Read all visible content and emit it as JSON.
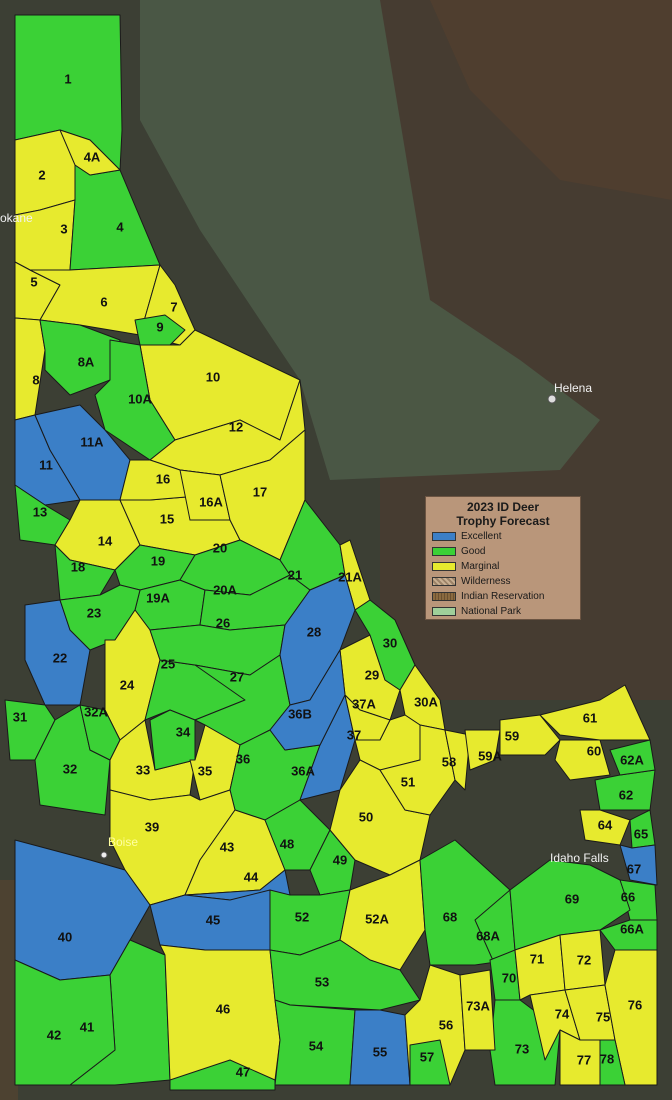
{
  "legend": {
    "title_line1": "2023 ID Deer",
    "title_line2": "Trophy Forecast",
    "items": [
      {
        "label": "Excellent",
        "color": "#3b7fc7"
      },
      {
        "label": "Good",
        "color": "#3bd136"
      },
      {
        "label": "Marginal",
        "color": "#e7ea2e"
      },
      {
        "label": "Wilderness",
        "color": "#b59c7e"
      },
      {
        "label": "Indian Reservation",
        "color": "#7a5d38"
      },
      {
        "label": "National Park",
        "color": "#9fcf9a"
      }
    ]
  },
  "cities": {
    "helena": "Helena",
    "boise": "Boise",
    "idaho_falls": "Idaho Falls",
    "spokane_partial": "okane"
  },
  "units": [
    {
      "id": "1",
      "rating": "good"
    },
    {
      "id": "2",
      "rating": "marginal"
    },
    {
      "id": "3",
      "rating": "marginal"
    },
    {
      "id": "4",
      "rating": "good"
    },
    {
      "id": "4A",
      "rating": "marginal"
    },
    {
      "id": "5",
      "rating": "marginal"
    },
    {
      "id": "6",
      "rating": "marginal"
    },
    {
      "id": "7",
      "rating": "marginal"
    },
    {
      "id": "8",
      "rating": "marginal"
    },
    {
      "id": "8A",
      "rating": "good"
    },
    {
      "id": "9",
      "rating": "good"
    },
    {
      "id": "10",
      "rating": "marginal"
    },
    {
      "id": "10A",
      "rating": "good"
    },
    {
      "id": "11",
      "rating": "excellent"
    },
    {
      "id": "11A",
      "rating": "excellent"
    },
    {
      "id": "12",
      "rating": "marginal"
    },
    {
      "id": "13",
      "rating": "good"
    },
    {
      "id": "14",
      "rating": "marginal"
    },
    {
      "id": "15",
      "rating": "marginal"
    },
    {
      "id": "16",
      "rating": "marginal"
    },
    {
      "id": "16A",
      "rating": "marginal"
    },
    {
      "id": "17",
      "rating": "marginal"
    },
    {
      "id": "18",
      "rating": "good"
    },
    {
      "id": "19",
      "rating": "good"
    },
    {
      "id": "19A",
      "rating": "good"
    },
    {
      "id": "20",
      "rating": "good"
    },
    {
      "id": "20A",
      "rating": "good"
    },
    {
      "id": "21",
      "rating": "good"
    },
    {
      "id": "21A",
      "rating": "marginal"
    },
    {
      "id": "22",
      "rating": "excellent"
    },
    {
      "id": "23",
      "rating": "good"
    },
    {
      "id": "24",
      "rating": "marginal"
    },
    {
      "id": "25",
      "rating": "good"
    },
    {
      "id": "26",
      "rating": "good"
    },
    {
      "id": "27",
      "rating": "good"
    },
    {
      "id": "28",
      "rating": "excellent"
    },
    {
      "id": "29",
      "rating": "marginal"
    },
    {
      "id": "30",
      "rating": "good"
    },
    {
      "id": "30A",
      "rating": "marginal"
    },
    {
      "id": "31",
      "rating": "good"
    },
    {
      "id": "32",
      "rating": "good"
    },
    {
      "id": "32A",
      "rating": "good"
    },
    {
      "id": "33",
      "rating": "marginal"
    },
    {
      "id": "34",
      "rating": "good"
    },
    {
      "id": "35",
      "rating": "marginal"
    },
    {
      "id": "36",
      "rating": "good"
    },
    {
      "id": "36A",
      "rating": "excellent"
    },
    {
      "id": "36B",
      "rating": "excellent"
    },
    {
      "id": "37",
      "rating": "marginal"
    },
    {
      "id": "37A",
      "rating": "marginal"
    },
    {
      "id": "39",
      "rating": "marginal"
    },
    {
      "id": "40",
      "rating": "excellent"
    },
    {
      "id": "41",
      "rating": "good"
    },
    {
      "id": "42",
      "rating": "good"
    },
    {
      "id": "43",
      "rating": "marginal"
    },
    {
      "id": "44",
      "rating": "excellent"
    },
    {
      "id": "45",
      "rating": "excellent"
    },
    {
      "id": "46",
      "rating": "marginal"
    },
    {
      "id": "47",
      "rating": "good"
    },
    {
      "id": "48",
      "rating": "good"
    },
    {
      "id": "49",
      "rating": "good"
    },
    {
      "id": "50",
      "rating": "marginal"
    },
    {
      "id": "51",
      "rating": "marginal"
    },
    {
      "id": "52",
      "rating": "good"
    },
    {
      "id": "52A",
      "rating": "marginal"
    },
    {
      "id": "53",
      "rating": "good"
    },
    {
      "id": "54",
      "rating": "good"
    },
    {
      "id": "55",
      "rating": "excellent"
    },
    {
      "id": "56",
      "rating": "marginal"
    },
    {
      "id": "57",
      "rating": "good"
    },
    {
      "id": "58",
      "rating": "marginal"
    },
    {
      "id": "59",
      "rating": "marginal"
    },
    {
      "id": "59A",
      "rating": "marginal"
    },
    {
      "id": "60",
      "rating": "marginal"
    },
    {
      "id": "61",
      "rating": "marginal"
    },
    {
      "id": "62",
      "rating": "good"
    },
    {
      "id": "62A",
      "rating": "good"
    },
    {
      "id": "64",
      "rating": "marginal"
    },
    {
      "id": "65",
      "rating": "good"
    },
    {
      "id": "66",
      "rating": "good"
    },
    {
      "id": "66A",
      "rating": "good"
    },
    {
      "id": "67",
      "rating": "excellent"
    },
    {
      "id": "68",
      "rating": "good"
    },
    {
      "id": "68A",
      "rating": "good"
    },
    {
      "id": "69",
      "rating": "good"
    },
    {
      "id": "70",
      "rating": "good"
    },
    {
      "id": "71",
      "rating": "marginal"
    },
    {
      "id": "72",
      "rating": "marginal"
    },
    {
      "id": "73",
      "rating": "good"
    },
    {
      "id": "73A",
      "rating": "marginal"
    },
    {
      "id": "74",
      "rating": "marginal"
    },
    {
      "id": "75",
      "rating": "marginal"
    },
    {
      "id": "76",
      "rating": "marginal"
    },
    {
      "id": "77",
      "rating": "marginal"
    },
    {
      "id": "78",
      "rating": "good"
    }
  ]
}
